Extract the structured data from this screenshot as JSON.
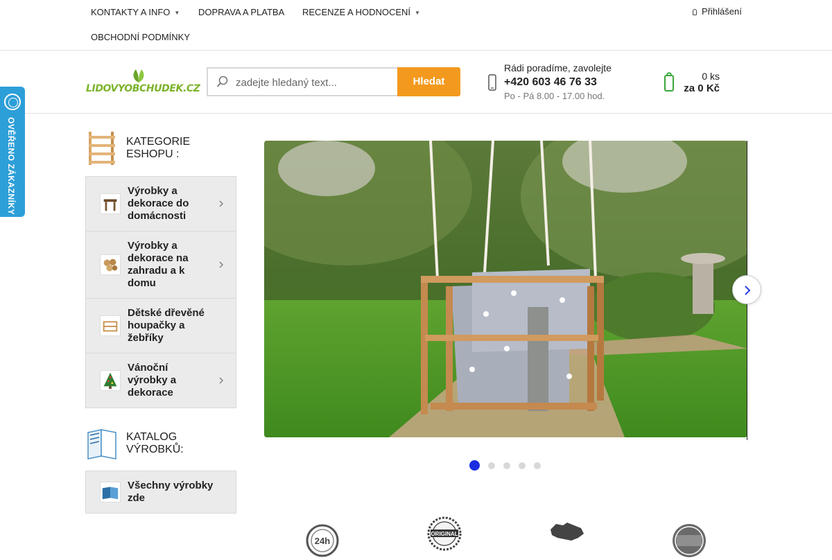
{
  "topnav": {
    "items": [
      {
        "label": "KONTAKTY A INFO",
        "has_dropdown": true
      },
      {
        "label": "DOPRAVA A PLATBA",
        "has_dropdown": false
      },
      {
        "label": "RECENZE A HODNOCENÍ",
        "has_dropdown": true
      },
      {
        "label": "OBCHODNÍ PODMÍNKY",
        "has_dropdown": false
      }
    ],
    "login_label": "Přihlášení"
  },
  "header": {
    "logo_text": "LIDOVYOBCHUDEK.CZ",
    "search": {
      "placeholder": "zadejte hledaný text...",
      "button_label": "Hledat"
    },
    "contact": {
      "line1": "Rádi poradíme, zavolejte",
      "phone": "+420 603 46 76 33",
      "hours": "Po - Pá 8.00 - 17.00 hod."
    },
    "cart": {
      "qty": "0 ks",
      "total": "za 0 Kč"
    }
  },
  "badge": {
    "text": "OVĚŘENO ZÁKAZNÍKY"
  },
  "sidebar": {
    "categories_heading": "KATEGORIE ESHOPU :",
    "categories": [
      {
        "label": "Výrobky a dekorace do domácnosti",
        "has_submenu": true
      },
      {
        "label": "Výrobky a dekorace na zahradu a k domu",
        "has_submenu": true
      },
      {
        "label": "Dětské dřevěné houpačky a žebříky",
        "has_submenu": false
      },
      {
        "label": "Vánoční výrobky a dekorace",
        "has_submenu": true
      }
    ],
    "catalog_heading": "KATALOG VÝROBKŮ:",
    "catalog_link": "Všechny výrobky zde"
  },
  "slider": {
    "slide_count": 5,
    "active_index": 0
  },
  "features": [
    {
      "icon": "delivery-24h-icon"
    },
    {
      "icon": "original-seal-icon"
    },
    {
      "icon": "czech-map-icon"
    },
    {
      "icon": "verified-customers-icon"
    }
  ],
  "colors": {
    "accent": "#f39a1e",
    "logo_green": "#7cb32b",
    "badge_blue": "#2d9fd8",
    "dot_active": "#1a2de0"
  }
}
